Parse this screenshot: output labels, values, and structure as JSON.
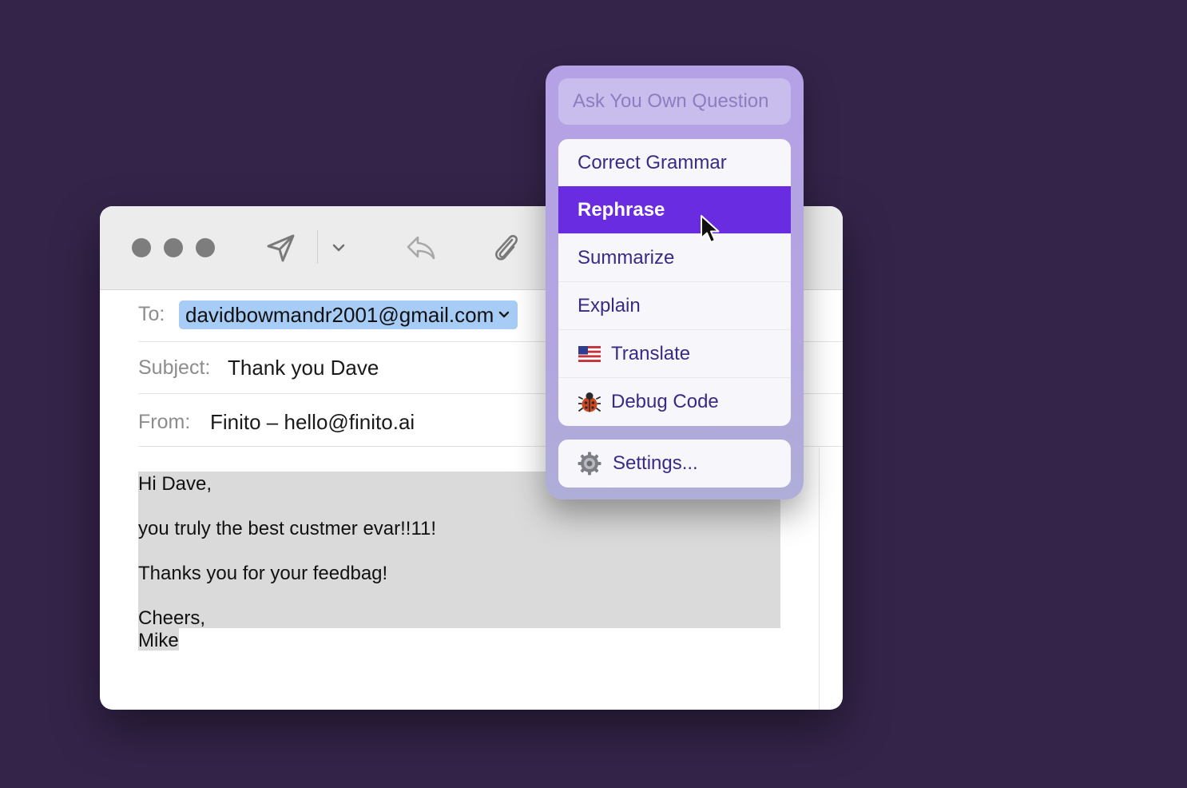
{
  "mail": {
    "to_label": "To:",
    "to_value": "davidbowmandr2001@gmail.com",
    "subject_label": "Subject:",
    "subject_value": "Thank you Dave",
    "from_label": "From:",
    "from_value": "Finito – hello@finito.ai",
    "body_lines": [
      "Hi Dave,",
      "you truly the best custmer evar!!11!",
      "Thanks you for your feedbag!",
      "Cheers,",
      "Mike"
    ],
    "toolbar_icons": [
      "send-icon",
      "chevron-down-icon",
      "reply-icon",
      "paperclip-icon"
    ]
  },
  "popup": {
    "ask_placeholder": "Ask You Own Question",
    "items": [
      {
        "label": "Correct Grammar",
        "icon": ""
      },
      {
        "label": "Rephrase",
        "icon": "",
        "active": true
      },
      {
        "label": "Summarize",
        "icon": ""
      },
      {
        "label": "Explain",
        "icon": ""
      },
      {
        "label": "Translate",
        "icon": "us-flag-icon"
      },
      {
        "label": "Debug Code",
        "icon": "ladybug-icon"
      }
    ],
    "settings_label": "Settings...",
    "settings_icon": "gear-icon",
    "colors": {
      "active_bg": "#6a2ce0",
      "item_text": "#3a2a86",
      "popup_bg": "#b5a2e6"
    }
  },
  "background_color": "#35244a"
}
